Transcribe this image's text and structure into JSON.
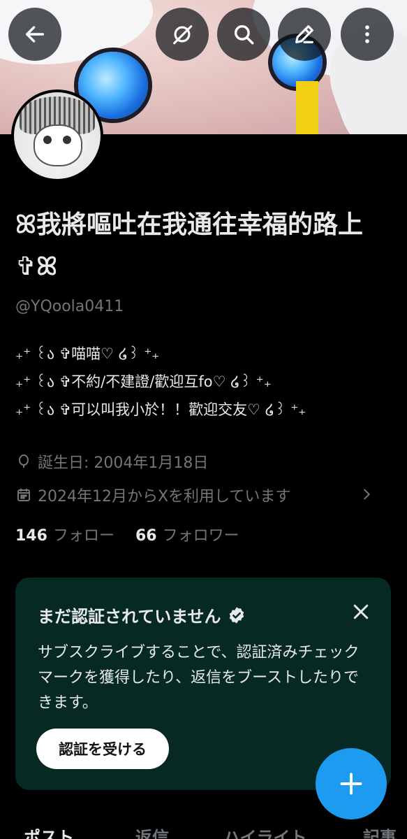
{
  "profile": {
    "name": "ꕤ我將嘔吐在我通往幸福的路上✞ꕤ",
    "handle": "@YQoola0411",
    "bio": [
      "₊⁺ ꒰ა ✞喵喵♡ ໒꒱ ⁺₊",
      "₊⁺ ꒰ა ✞不約/不建證/歡迎互fo♡ ໒꒱ ⁺₊",
      "₊⁺ ꒰ა ✞可以叫我小於！！歡迎交友♡ ໒꒱ ⁺₊"
    ],
    "birthday": "誕生日: 2004年1月18日",
    "joined": "2024年12月からXを利用しています",
    "following_count": "146",
    "following_label": "フォロー",
    "followers_count": "66",
    "followers_label": "フォロワー"
  },
  "verify_card": {
    "title": "まだ認証されていません",
    "description": "サブスクライブすることで、認証済みチェックマークを獲得したり、返信をブーストしたりできます。",
    "button": "認証を受ける"
  },
  "tabs": [
    {
      "label": "ポスト",
      "active": true
    },
    {
      "label": "返信",
      "active": false
    },
    {
      "label": "ハイライト",
      "active": false
    },
    {
      "label": "記事",
      "active": false
    }
  ],
  "colors": {
    "accent": "#1d9bf0",
    "card_bg": "#062a23",
    "secondary_text": "#71767b"
  }
}
